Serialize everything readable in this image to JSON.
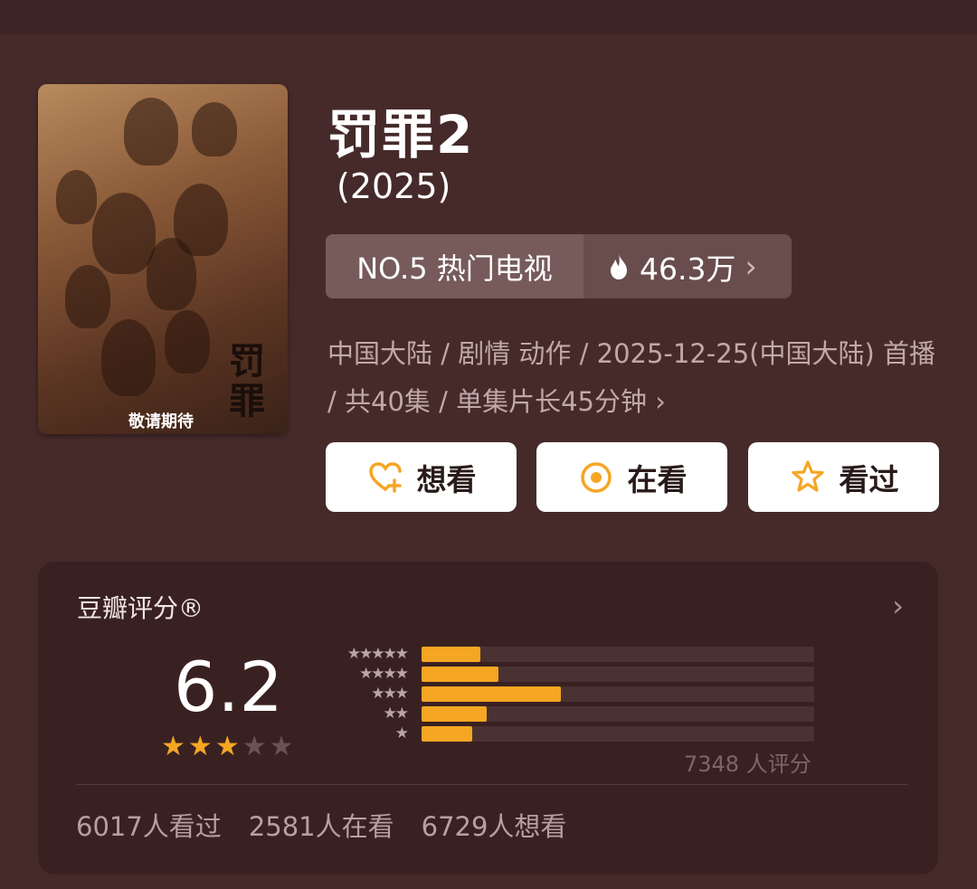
{
  "poster": {
    "vertical_title": "罚罪",
    "tagline": "敬请期待"
  },
  "title": "罚罪2",
  "year": "(2025)",
  "rank": {
    "label": "NO.5 热门电视",
    "heat": "46.3万"
  },
  "meta": "中国大陆 / 剧情 动作 / 2025-12-25(中国大陆) 首播 / 共40集 / 单集片长45分钟",
  "buttons": {
    "want": "想看",
    "watching": "在看",
    "watched": "看过"
  },
  "rating": {
    "label": "豆瓣评分®",
    "score": "6.2",
    "stars_filled": 3,
    "stars_total": 5,
    "distribution": [
      {
        "stars": 5,
        "fraction": 0.15
      },
      {
        "stars": 4,
        "fraction": 0.195
      },
      {
        "stars": 3,
        "fraction": 0.355
      },
      {
        "stars": 2,
        "fraction": 0.165
      },
      {
        "stars": 1,
        "fraction": 0.13
      }
    ],
    "total": "7348 人评分"
  },
  "counts": {
    "watched": "6017人看过",
    "watching": "2581人在看",
    "want": "6729人想看"
  },
  "colors": {
    "accent": "#f5a623",
    "bg": "#462a2a",
    "card": "#3a2121"
  }
}
